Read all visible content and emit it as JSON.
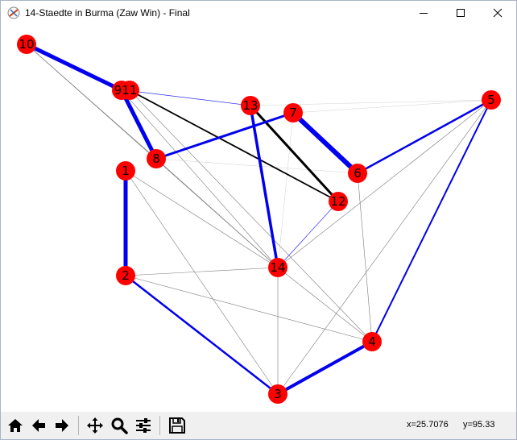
{
  "window": {
    "title": "14-Staedte in Burma (Zaw Win) - Final"
  },
  "toolbar": {
    "icons": [
      "home-icon",
      "back-arrow-icon",
      "forward-arrow-icon",
      "pan-icon",
      "zoom-icon",
      "configure-subplots-icon",
      "save-icon"
    ],
    "coord_x": "x=25.7076",
    "coord_y": "y=95.33"
  },
  "colors": {
    "node": "#ff0000",
    "tour_edge": "#0000ee",
    "black_edge": "#000000",
    "thin_edge": "#888888"
  },
  "graph": {
    "nodes": [
      "10",
      "911",
      "13",
      "7",
      "5",
      "8",
      "6",
      "1",
      "12",
      "14",
      "2",
      "4",
      "3"
    ]
  }
}
